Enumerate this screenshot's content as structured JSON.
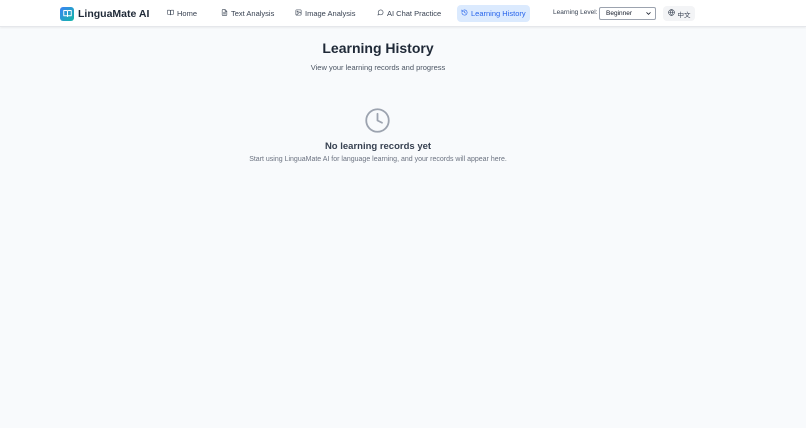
{
  "header": {
    "brand_name": "LinguaMate AI",
    "nav": [
      {
        "label": "Home",
        "icon": "book-open-icon"
      },
      {
        "label": "Text Analysis",
        "icon": "file-text-icon"
      },
      {
        "label": "Image Analysis",
        "icon": "image-icon"
      },
      {
        "label": "AI Chat Practice",
        "icon": "message-circle-icon"
      },
      {
        "label": "Learning History",
        "icon": "history-icon",
        "active": true
      }
    ],
    "level_label": "Learning Level:",
    "level_value": "Beginner",
    "language_toggle": "中文"
  },
  "main": {
    "title": "Learning History",
    "subtitle": "View your learning records and progress",
    "empty_title": "No learning records yet",
    "empty_description": "Start using LinguaMate AI for language learning, and your records will appear here."
  },
  "colors": {
    "accent": "#2563eb",
    "active_nav_bg": "#dbeafe",
    "page_bg": "#f8fafc",
    "empty_icon": "#9ca3af"
  }
}
